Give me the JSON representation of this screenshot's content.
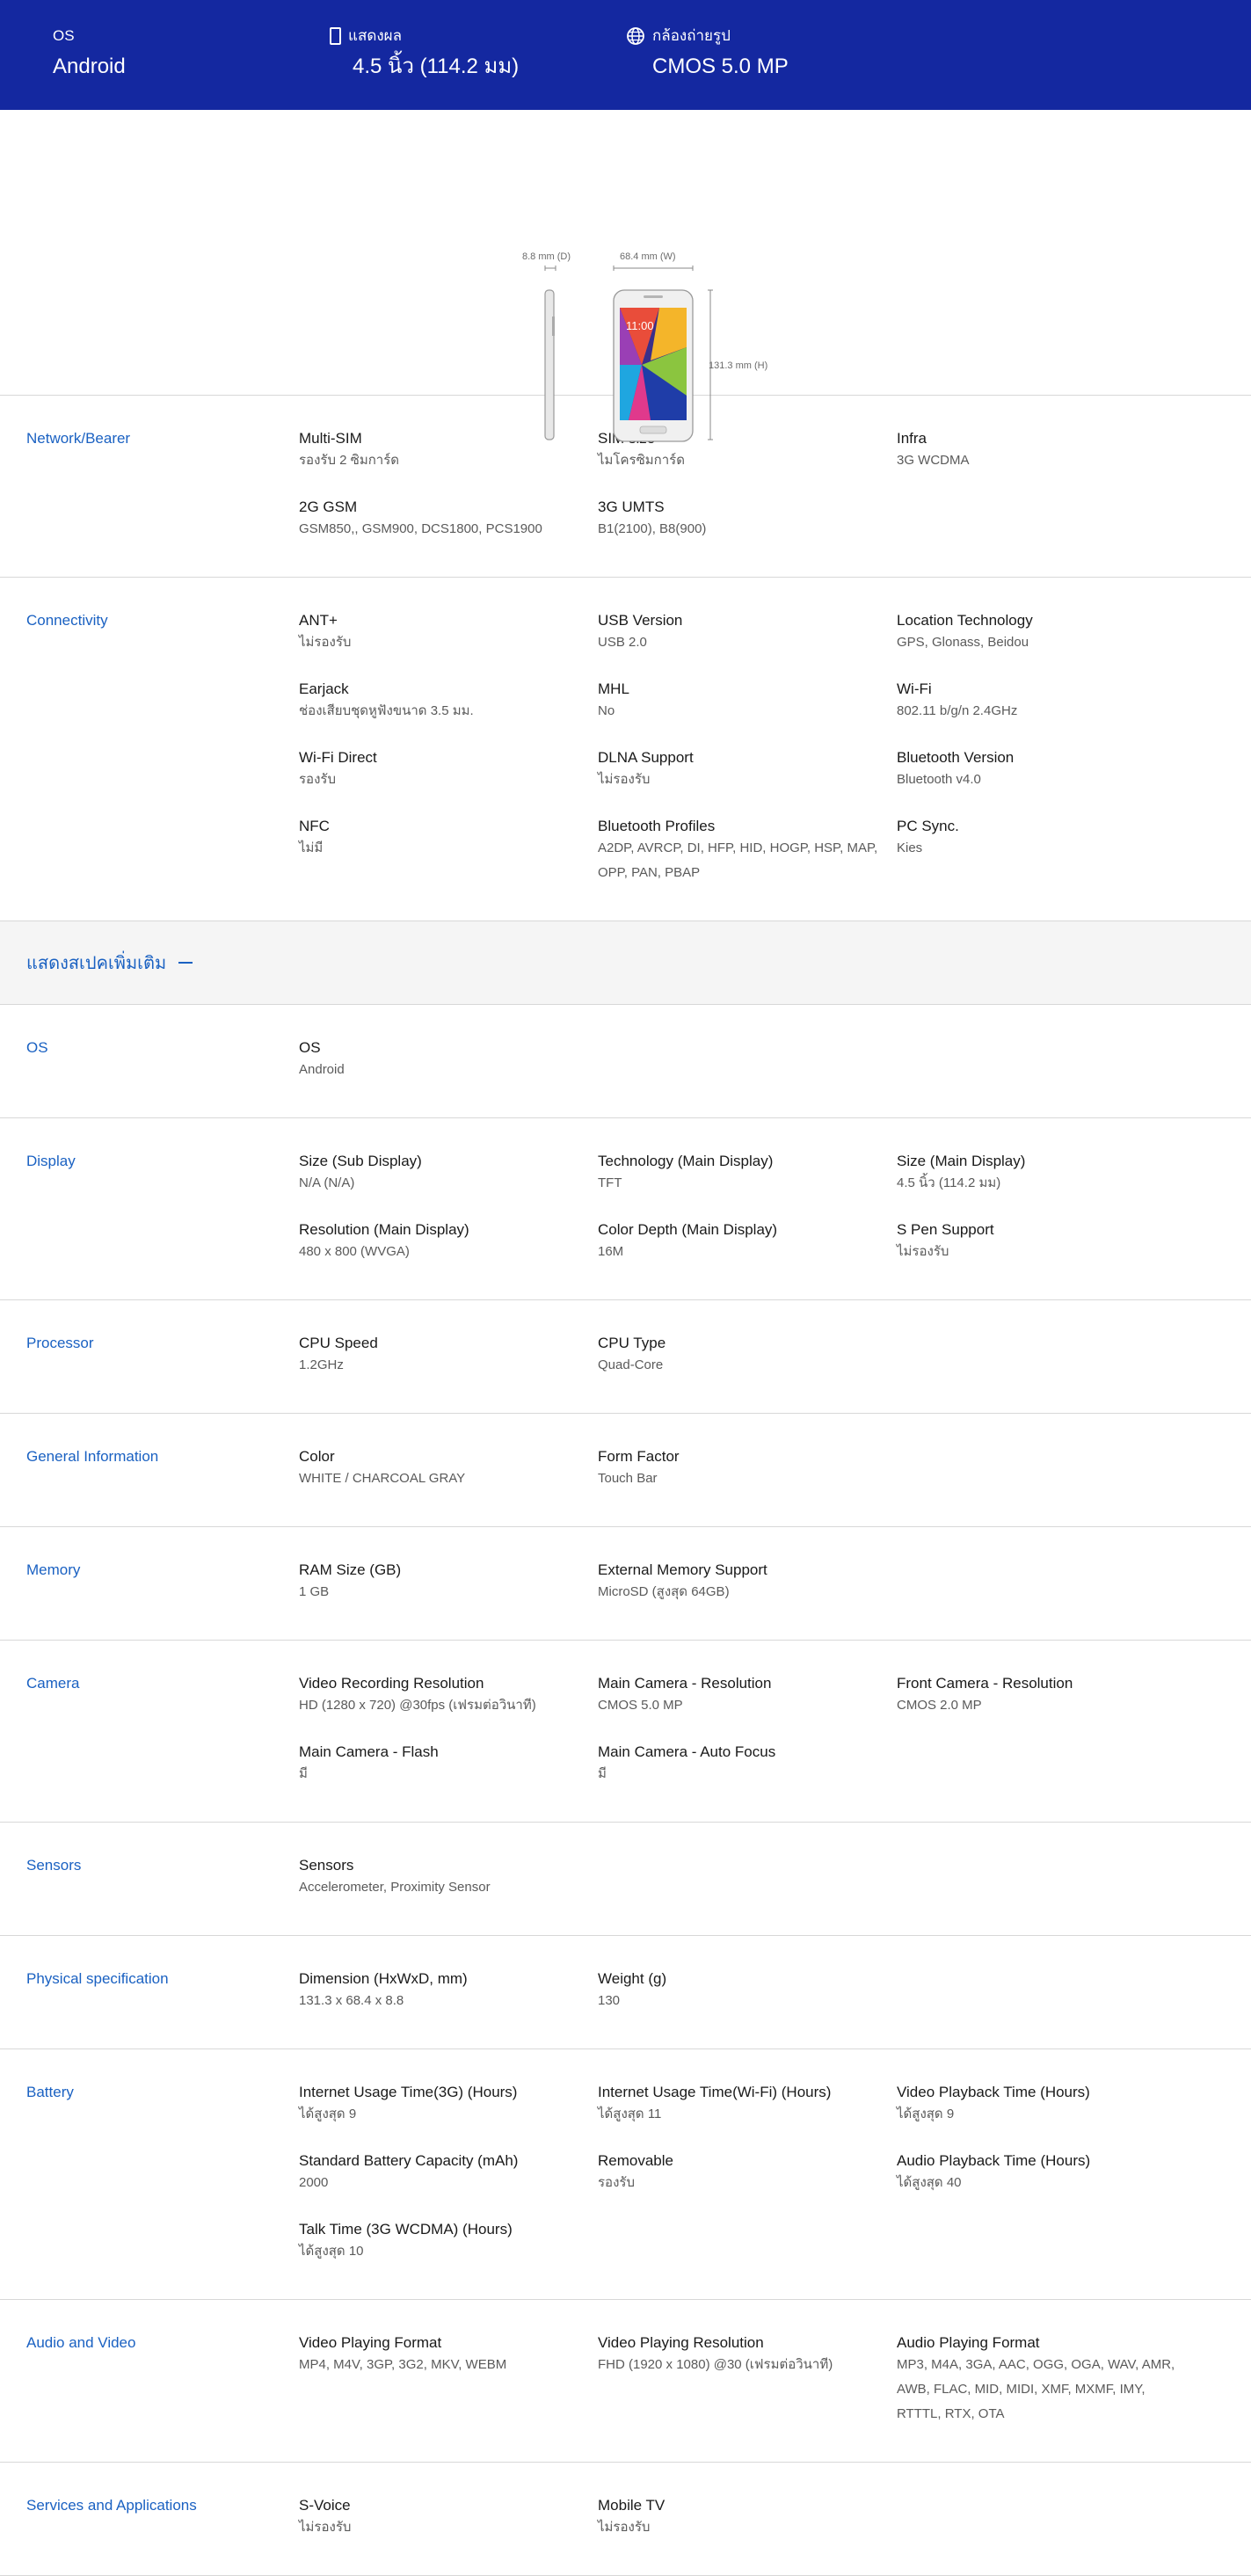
{
  "banner": {
    "os_label": "OS",
    "os_value": "Android",
    "display_label": "แสดงผล",
    "display_value": "4.5 นิ้ว (114.2 มม)",
    "camera_label": "กล้องถ่ายรูป",
    "camera_value": "CMOS 5.0 MP"
  },
  "hero": {
    "depth_label": "8.8 mm (D)",
    "width_label": "68.4 mm (W)",
    "height_label": "131.3 mm (H)",
    "screen_time": "11:00"
  },
  "more_specs_label": "แสดงสเปคเพิ่มเติม",
  "sections": [
    {
      "category": "Network/Bearer",
      "specs": [
        {
          "name": "Multi-SIM",
          "value": "รองรับ 2 ซิมการ์ด"
        },
        {
          "name": "SIM size",
          "value": "ไมโครซิมการ์ด"
        },
        {
          "name": "Infra",
          "value": "3G WCDMA"
        },
        {
          "name": "2G GSM",
          "value": "GSM850,, GSM900, DCS1800, PCS1900"
        },
        {
          "name": "3G UMTS",
          "value": "B1(2100), B8(900)"
        }
      ]
    },
    {
      "category": "Connectivity",
      "specs": [
        {
          "name": "ANT+",
          "value": "ไม่รองรับ"
        },
        {
          "name": "USB Version",
          "value": "USB 2.0"
        },
        {
          "name": "Location Technology",
          "value": "GPS, Glonass, Beidou"
        },
        {
          "name": "Earjack",
          "value": "ช่องเสียบชุดหูฟังขนาด 3.5 มม."
        },
        {
          "name": "MHL",
          "value": "No"
        },
        {
          "name": "Wi-Fi",
          "value": "802.11 b/g/n 2.4GHz"
        },
        {
          "name": "Wi-Fi Direct",
          "value": "รองรับ"
        },
        {
          "name": "DLNA Support",
          "value": "ไม่รองรับ"
        },
        {
          "name": "Bluetooth Version",
          "value": "Bluetooth v4.0"
        },
        {
          "name": "NFC",
          "value": "ไม่มี"
        },
        {
          "name": "Bluetooth Profiles",
          "value": "A2DP, AVRCP, DI, HFP, HID, HOGP, HSP, MAP, OPP, PAN, PBAP"
        },
        {
          "name": "PC Sync.",
          "value": "Kies"
        }
      ]
    }
  ],
  "more_sections": [
    {
      "category": "OS",
      "specs": [
        {
          "name": "OS",
          "value": "Android"
        }
      ]
    },
    {
      "category": "Display",
      "specs": [
        {
          "name": "Size (Sub Display)",
          "value": "N/A (N/A)"
        },
        {
          "name": "Technology (Main Display)",
          "value": "TFT"
        },
        {
          "name": "Size (Main Display)",
          "value": "4.5 นิ้ว (114.2 มม)"
        },
        {
          "name": "Resolution (Main Display)",
          "value": "480 x 800 (WVGA)"
        },
        {
          "name": "Color Depth (Main Display)",
          "value": "16M"
        },
        {
          "name": "S Pen Support",
          "value": "ไม่รองรับ"
        }
      ]
    },
    {
      "category": "Processor",
      "specs": [
        {
          "name": "CPU Speed",
          "value": "1.2GHz"
        },
        {
          "name": "CPU Type",
          "value": "Quad-Core"
        }
      ]
    },
    {
      "category": "General Information",
      "specs": [
        {
          "name": "Color",
          "value": "WHITE / CHARCOAL GRAY"
        },
        {
          "name": "Form Factor",
          "value": "Touch Bar"
        }
      ]
    },
    {
      "category": "Memory",
      "specs": [
        {
          "name": "RAM Size (GB)",
          "value": "1 GB"
        },
        {
          "name": "External Memory Support",
          "value": "MicroSD (สูงสุด 64GB)"
        }
      ]
    },
    {
      "category": "Camera",
      "specs": [
        {
          "name": "Video Recording Resolution",
          "value": "HD (1280 x 720) @30fps (เฟรมต่อวินาที)"
        },
        {
          "name": "Main Camera - Resolution",
          "value": "CMOS 5.0 MP"
        },
        {
          "name": "Front Camera - Resolution",
          "value": "CMOS 2.0 MP"
        },
        {
          "name": "Main Camera - Flash",
          "value": "มี"
        },
        {
          "name": "Main Camera - Auto Focus",
          "value": "มี"
        }
      ]
    },
    {
      "category": "Sensors",
      "specs": [
        {
          "name": "Sensors",
          "value": "Accelerometer, Proximity Sensor"
        }
      ]
    },
    {
      "category": "Physical specification",
      "specs": [
        {
          "name": "Dimension (HxWxD, mm)",
          "value": "131.3 x 68.4 x 8.8"
        },
        {
          "name": "Weight (g)",
          "value": "130"
        }
      ]
    },
    {
      "category": "Battery",
      "specs": [
        {
          "name": "Internet Usage Time(3G) (Hours)",
          "value": "ได้สูงสุด 9"
        },
        {
          "name": "Internet Usage Time(Wi-Fi) (Hours)",
          "value": "ได้สูงสุด 11"
        },
        {
          "name": "Video Playback Time (Hours)",
          "value": "ได้สูงสุด 9"
        },
        {
          "name": "Standard Battery Capacity (mAh)",
          "value": "2000"
        },
        {
          "name": "Removable",
          "value": "รองรับ"
        },
        {
          "name": "Audio Playback Time (Hours)",
          "value": "ได้สูงสุด 40"
        },
        {
          "name": "Talk Time (3G WCDMA) (Hours)",
          "value": "ได้สูงสุด 10"
        }
      ]
    },
    {
      "category": "Audio and Video",
      "specs": [
        {
          "name": "Video Playing Format",
          "value": "MP4, M4V, 3GP, 3G2, MKV, WEBM"
        },
        {
          "name": "Video Playing Resolution",
          "value": "FHD (1920 x 1080) @30 (เฟรมต่อวินาที)"
        },
        {
          "name": "Audio Playing Format",
          "value": "MP3, M4A, 3GA, AAC, OGG, OGA, WAV, AMR, AWB, FLAC, MID, MIDI, XMF, MXMF, IMY, RTTTL, RTX, OTA"
        }
      ]
    },
    {
      "category": "Services and Applications",
      "specs": [
        {
          "name": "S-Voice",
          "value": "ไม่รองรับ"
        },
        {
          "name": "Mobile TV",
          "value": "ไม่รองรับ"
        }
      ]
    }
  ]
}
